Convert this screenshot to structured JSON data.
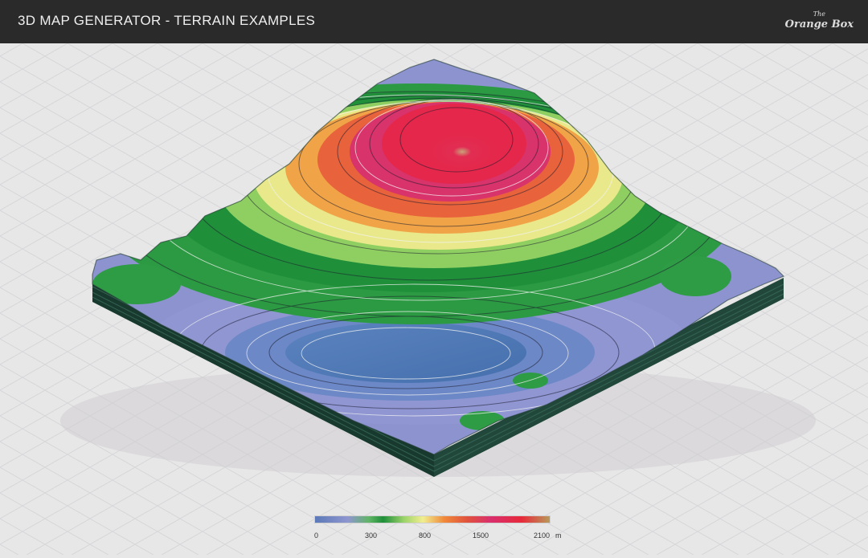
{
  "header": {
    "title": "3D MAP GENERATOR - TERRAIN EXAMPLES",
    "logo_top": "The",
    "logo_bottom": "Orange Box"
  },
  "legend": {
    "ticks": [
      "0",
      "300",
      "800",
      "1500",
      "2100"
    ],
    "unit": "m"
  },
  "colors": {
    "header_bg": "#2b2a2b",
    "page_bg": "#e8e7e8",
    "water": "#4f78b6",
    "lowland": "#8c93cf",
    "forest": "#1f8f3a",
    "peak": "#e22d52"
  }
}
